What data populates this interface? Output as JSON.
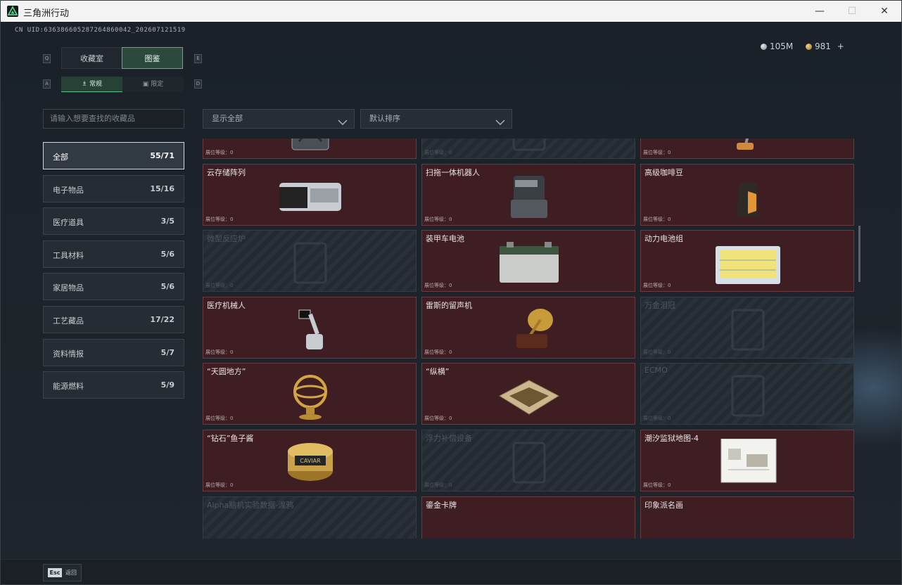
{
  "window": {
    "title": "三角洲行动",
    "min": "—",
    "max": "☐",
    "close": "✕"
  },
  "uid": "CN UID:636386605287264860042_202607121519",
  "currency": {
    "silver": "105M",
    "gold": "981",
    "plus": "+"
  },
  "tabs": [
    {
      "label": "收藏室",
      "active": false
    },
    {
      "label": "图鉴",
      "active": true
    }
  ],
  "tab_keys": {
    "left": "Q",
    "right": "E"
  },
  "subtabs": [
    {
      "label": "常规",
      "icon": "flask-icon",
      "active": true
    },
    {
      "label": "限定",
      "icon": "box-icon",
      "active": false
    }
  ],
  "subtab_keys": {
    "left": "A",
    "right": "D"
  },
  "search": {
    "placeholder": "请输入想要查找的收藏品"
  },
  "categories": [
    {
      "label": "全部",
      "count": "55/71",
      "active": true
    },
    {
      "label": "电子物品",
      "count": "15/16"
    },
    {
      "label": "医疗道具",
      "count": "3/5"
    },
    {
      "label": "工具材料",
      "count": "5/6"
    },
    {
      "label": "家居物品",
      "count": "5/6"
    },
    {
      "label": "工艺藏品",
      "count": "17/22"
    },
    {
      "label": "资料情报",
      "count": "5/7"
    },
    {
      "label": "能源燃料",
      "count": "5/9"
    }
  ],
  "filters": {
    "show": "显示全部",
    "sort": "默认排序"
  },
  "level_label": "展位等级：0",
  "items": [
    {
      "name": "",
      "locked": false,
      "art": "fuel-can"
    },
    {
      "name": "",
      "locked": true,
      "art": "machine"
    },
    {
      "name": "",
      "locked": false,
      "art": "vacuum"
    },
    {
      "name": "云存储阵列",
      "locked": false,
      "art": "server"
    },
    {
      "name": "扫拖一体机器人",
      "locked": false,
      "art": "robot-mop"
    },
    {
      "name": "高级咖啡豆",
      "locked": false,
      "art": "coffee-bag"
    },
    {
      "name": "微型反应炉",
      "locked": true,
      "art": "reactor"
    },
    {
      "name": "装甲车电池",
      "locked": false,
      "art": "battery"
    },
    {
      "name": "动力电池组",
      "locked": false,
      "art": "battery-pack"
    },
    {
      "name": "医疗机械人",
      "locked": false,
      "art": "med-robot"
    },
    {
      "name": "雷斯的留声机",
      "locked": false,
      "art": "gramophone"
    },
    {
      "name": "万金泪冠",
      "locked": true,
      "art": "crown"
    },
    {
      "name": "“天圆地方”",
      "locked": false,
      "art": "armillary"
    },
    {
      "name": "“纵横”",
      "locked": false,
      "art": "chessboard"
    },
    {
      "name": "ECMO",
      "locked": true,
      "art": "ecmo"
    },
    {
      "name": "“钻石”鱼子酱",
      "locked": false,
      "art": "caviar"
    },
    {
      "name": "浮力补偿设备",
      "locked": true,
      "art": "bcd"
    },
    {
      "name": "潮汐监狱地图-4",
      "locked": false,
      "art": "map"
    },
    {
      "name": "Alpha脑机实验数据-渡鸦",
      "locked": true,
      "art": "none"
    },
    {
      "name": "鎏金卡牌",
      "locked": false,
      "art": "none"
    },
    {
      "name": "印象派名画",
      "locked": false,
      "art": "none"
    }
  ],
  "caviar_label": "CAVIAR",
  "esc": {
    "key": "Esc",
    "label": "返回"
  }
}
